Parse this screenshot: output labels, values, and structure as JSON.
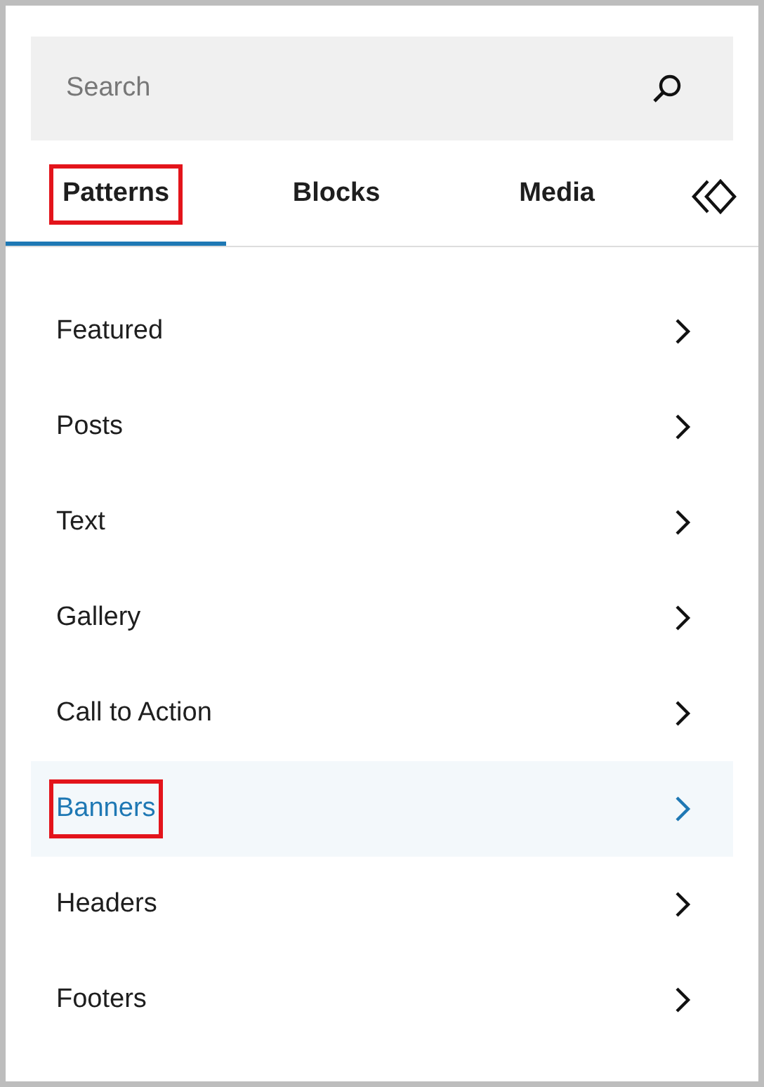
{
  "search": {
    "placeholder": "Search"
  },
  "tabs": [
    {
      "label": "Patterns",
      "selected": true,
      "highlighted": true
    },
    {
      "label": "Blocks",
      "selected": false,
      "highlighted": false
    },
    {
      "label": "Media",
      "selected": false,
      "highlighted": false
    }
  ],
  "categories": [
    {
      "label": "Featured",
      "selected": false,
      "highlighted": false
    },
    {
      "label": "Posts",
      "selected": false,
      "highlighted": false
    },
    {
      "label": "Text",
      "selected": false,
      "highlighted": false
    },
    {
      "label": "Gallery",
      "selected": false,
      "highlighted": false
    },
    {
      "label": "Call to Action",
      "selected": false,
      "highlighted": false
    },
    {
      "label": "Banners",
      "selected": true,
      "highlighted": true
    },
    {
      "label": "Headers",
      "selected": false,
      "highlighted": false
    },
    {
      "label": "Footers",
      "selected": false,
      "highlighted": false
    }
  ]
}
